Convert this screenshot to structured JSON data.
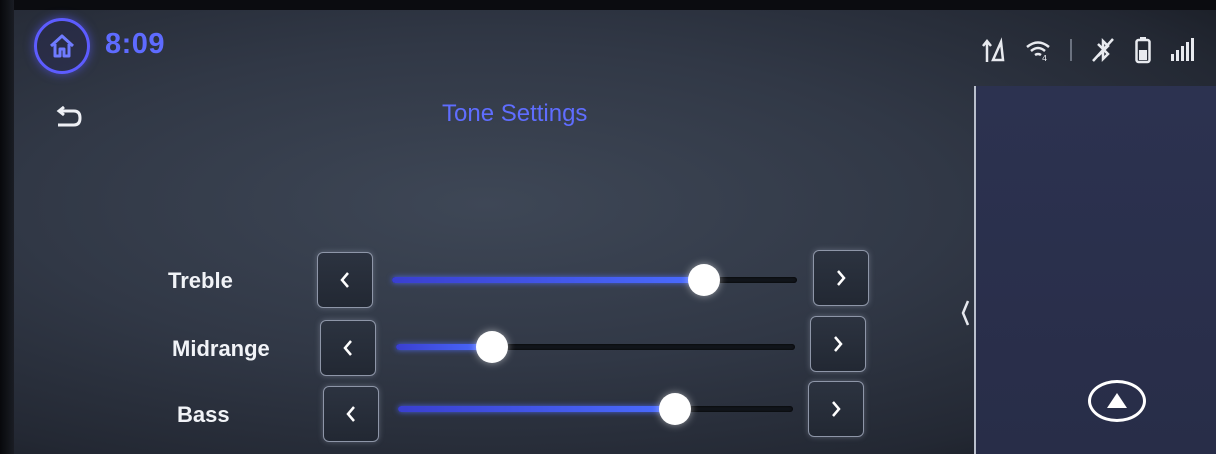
{
  "header": {
    "clock": "8:09",
    "status_icons": [
      "data-transfer-icon",
      "wifi-icon",
      "bluetooth-off-icon",
      "phone-battery-icon",
      "signal-strength-icon"
    ]
  },
  "page": {
    "title": "Tone Settings"
  },
  "tone": {
    "treble": {
      "label": "Treble",
      "level": 0.77
    },
    "midrange": {
      "label": "Midrange",
      "level": 0.24
    },
    "bass": {
      "label": "Bass",
      "level": 0.7
    }
  },
  "colors": {
    "accent": "#5e6bff",
    "slider_fill": "#4a6cff",
    "thumb": "#ffffff"
  }
}
